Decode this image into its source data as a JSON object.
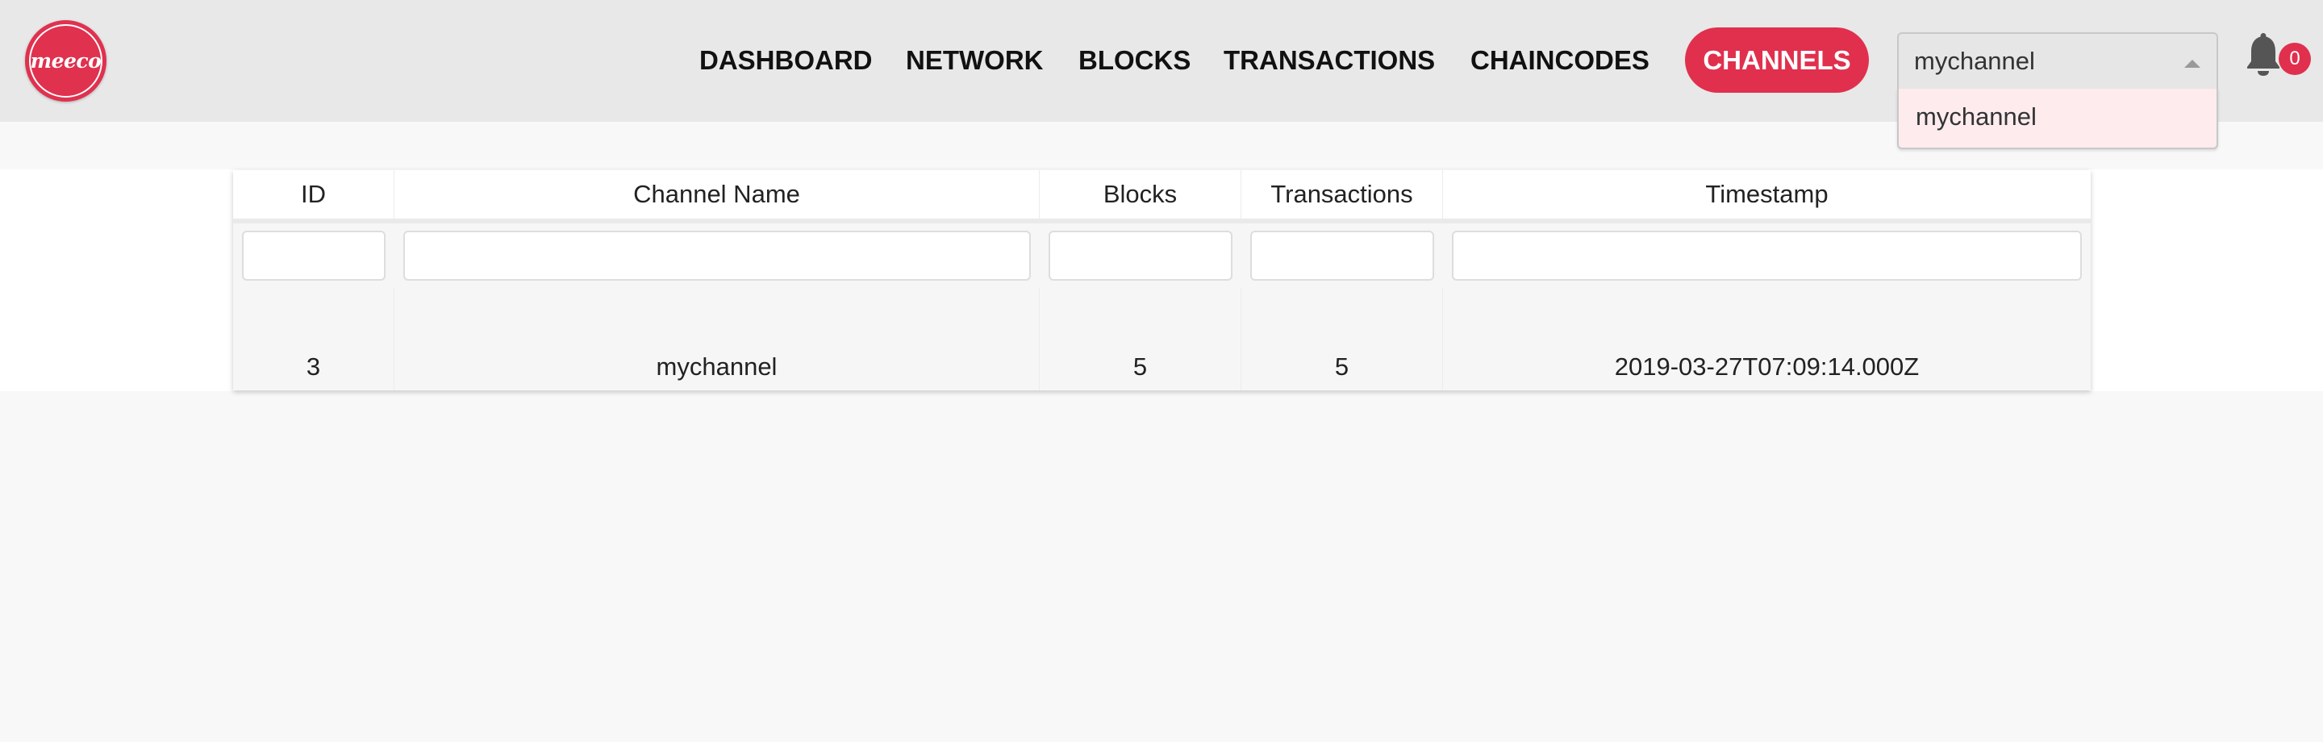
{
  "brand": {
    "logo_text": "meeco",
    "accent_color": "#e0304d"
  },
  "nav": {
    "items": [
      {
        "label": "DASHBOARD"
      },
      {
        "label": "NETWORK"
      },
      {
        "label": "BLOCKS"
      },
      {
        "label": "TRANSACTIONS"
      },
      {
        "label": "CHAINCODES"
      }
    ],
    "active_label": "CHANNELS"
  },
  "channel_select": {
    "value": "mychannel",
    "options": [
      "mychannel"
    ]
  },
  "notifications": {
    "icon": "bell-icon",
    "count": "0"
  },
  "table": {
    "columns": [
      "ID",
      "Channel Name",
      "Blocks",
      "Transactions",
      "Timestamp"
    ],
    "filters": [
      "",
      "",
      "",
      "",
      ""
    ],
    "rows": [
      {
        "id": "3",
        "channel_name": "mychannel",
        "blocks": "5",
        "transactions": "5",
        "timestamp": "2019-03-27T07:09:14.000Z"
      }
    ]
  }
}
